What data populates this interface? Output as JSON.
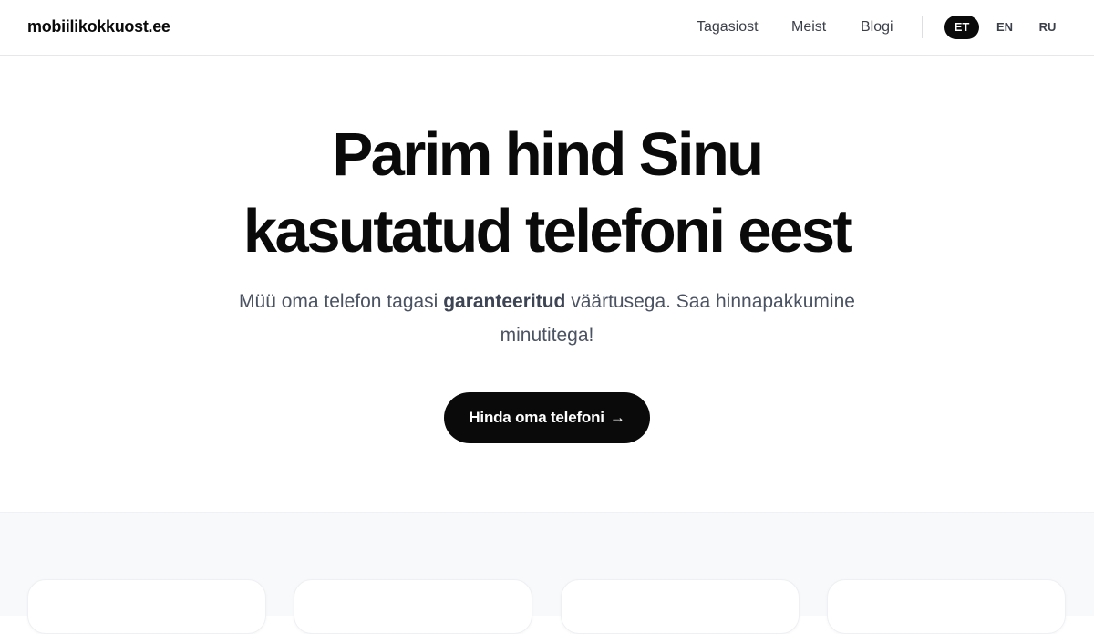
{
  "header": {
    "logo": "mobiilikokkuost.ee",
    "nav": [
      {
        "label": "Tagasiost"
      },
      {
        "label": "Meist"
      },
      {
        "label": "Blogi"
      }
    ],
    "languages": [
      {
        "code": "ET",
        "active": true
      },
      {
        "code": "EN",
        "active": false
      },
      {
        "code": "RU",
        "active": false
      }
    ]
  },
  "hero": {
    "title_line1": "Parim hind Sinu",
    "title_line2": "kasutatud telefoni eest",
    "subtitle_before": "Müü oma telefon tagasi ",
    "subtitle_bold": "garanteeritud",
    "subtitle_after": " väärtusega. Saa hinnapakkumine minutitega!",
    "cta_label": "Hinda oma telefoni",
    "cta_arrow": "→"
  },
  "colors": {
    "primary": "#0a0a0a",
    "text_muted": "#4b5363",
    "section_bg": "#f8f9fb"
  }
}
